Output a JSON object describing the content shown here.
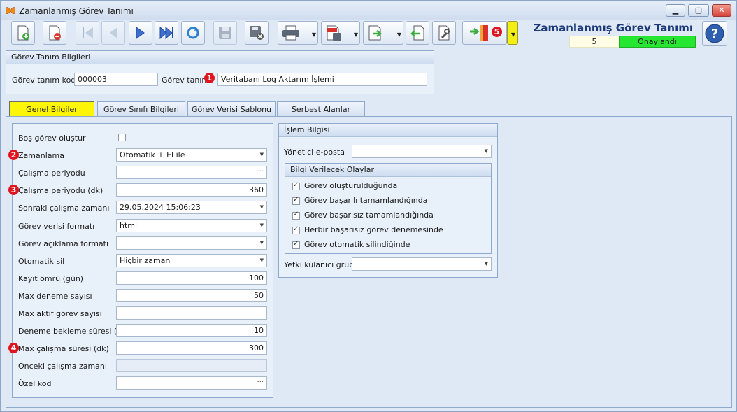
{
  "window": {
    "title": "Zamanlanmış Görev Tanımı",
    "minimize": "▁",
    "maximize": "▢",
    "close": "✕"
  },
  "header": {
    "title": "Zamanlanmış Görev Tanımı",
    "count": "5",
    "status": "Onaylandı"
  },
  "badges": [
    "1",
    "2",
    "3",
    "4",
    "5"
  ],
  "colors": {
    "status_green": "#27e631",
    "active_tab": "#fdf507",
    "badge_red": "#e0141e",
    "title_blue": "#1d3a78"
  },
  "info_group": {
    "title": "Görev Tanım Bilgileri",
    "code_label": "Görev tanım kodu",
    "code_value": "000003",
    "name_label": "Görev tanımı",
    "name_value": "Veritabanı Log Aktarım İşlemi"
  },
  "tabs": [
    "Genel Bilgiler",
    "Görev Sınıfı Bilgileri",
    "Görev Verisi Şablonu",
    "Serbest Alanlar"
  ],
  "general": {
    "fields": [
      {
        "label": "Boş görev oluştur",
        "value": ""
      },
      {
        "label": "Zamanlama",
        "value": "Otomatik + El ile"
      },
      {
        "label": "Çalışma periyodu",
        "value": ""
      },
      {
        "label": "Çalışma periyodu (dk)",
        "value": "360"
      },
      {
        "label": "Sonraki çalışma zamanı",
        "value": "29.05.2024 15:06:23"
      },
      {
        "label": "Görev verisi formatı",
        "value": "html"
      },
      {
        "label": "Görev açıklama formatı",
        "value": ""
      },
      {
        "label": "Otomatik sil",
        "value": "Hiçbir zaman"
      },
      {
        "label": "Kayıt ömrü (gün)",
        "value": "100"
      },
      {
        "label": "Max deneme sayısı",
        "value": "50"
      },
      {
        "label": "Max aktif görev sayısı",
        "value": ""
      },
      {
        "label": "Deneme bekleme süresi (dk)",
        "value": "10"
      },
      {
        "label": "Max çalışma süresi (dk)",
        "value": "300"
      },
      {
        "label": "Önceki çalışma zamanı",
        "value": ""
      },
      {
        "label": "Özel kod",
        "value": ""
      }
    ]
  },
  "process": {
    "title": "İşlem Bilgisi",
    "manager_email_label": "Yönetici e-posta",
    "events_title": "Bilgi Verilecek Olaylar",
    "events": [
      "Görev oluşturulduğunda",
      "Görev başarılı tamamlandığında",
      "Görev başarısız tamamlandığında",
      "Herbir başarısız görev denemesinde",
      "Görev otomatik silindiğinde"
    ],
    "user_group_label": "Yetki kulanıcı grubu"
  },
  "icons": {
    "app": "butterfly-icon",
    "new": "new-document-icon",
    "delete": "delete-document-icon",
    "first": "first-record-icon",
    "prev": "previous-record-icon",
    "next": "next-record-icon",
    "last": "last-record-icon",
    "refresh": "refresh-icon",
    "save": "save-icon",
    "cancel": "cancel-save-icon",
    "print": "printer-icon",
    "pdf": "pdf-export-icon",
    "export": "export-icon",
    "import": "import-icon",
    "tools": "tools-icon",
    "exit": "exit-door-icon",
    "help": "help-icon"
  }
}
